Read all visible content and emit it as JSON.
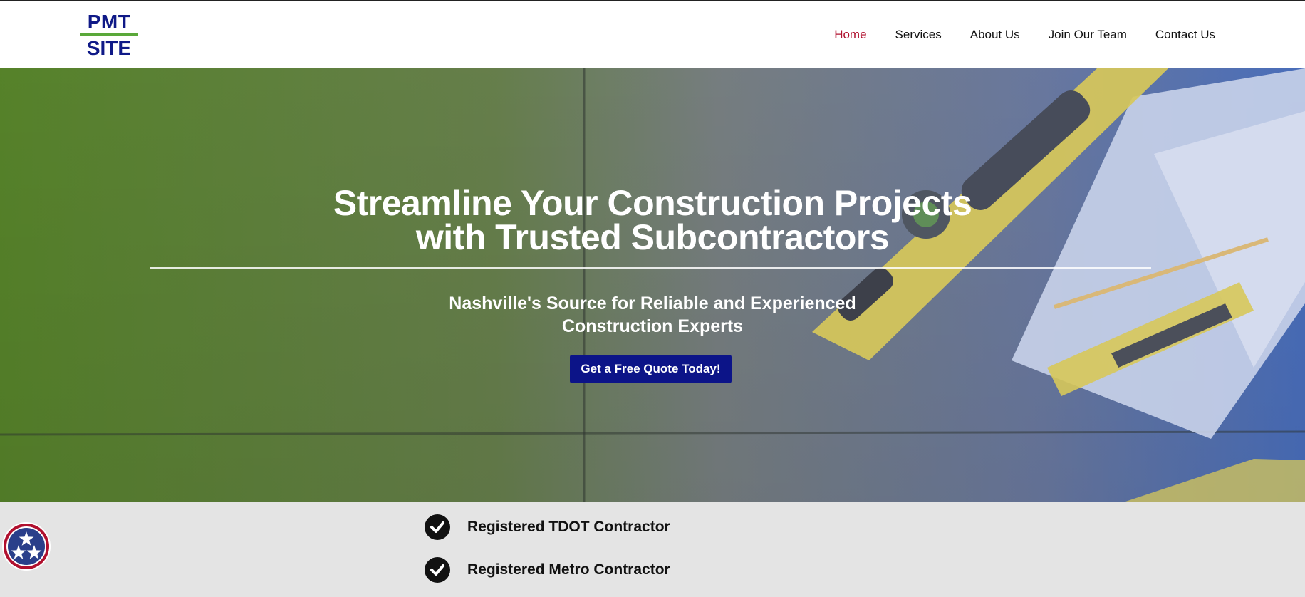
{
  "brand": {
    "line1": "PMT",
    "line2": "SITE",
    "primary_color": "#0f1987",
    "accent_color": "#5aa83a"
  },
  "nav": {
    "items": [
      {
        "label": "Home",
        "active": true
      },
      {
        "label": "Services",
        "active": false
      },
      {
        "label": "About Us",
        "active": false
      },
      {
        "label": "Join Our Team",
        "active": false
      },
      {
        "label": "Contact Us",
        "active": false
      }
    ],
    "active_color": "#b0102e"
  },
  "hero": {
    "title_line1": "Streamline Your Construction Projects",
    "title_line2": "with Trusted Subcontractors",
    "subtitle_line1": "Nashville's Source for Reliable and Experienced",
    "subtitle_line2": "Construction Experts",
    "cta_label": "Get a Free Quote Today!",
    "cta_color": "#0c1488",
    "gradient_colors": [
      "#5a8a2a",
      "#7a8a78",
      "#4a72c8"
    ]
  },
  "badges": {
    "items": [
      {
        "label": "Registered TDOT Contractor",
        "icon": "check-circle-icon"
      },
      {
        "label": "Registered Metro Contractor",
        "icon": "check-circle-icon"
      }
    ],
    "seal_icon": "tennessee-tri-star-icon"
  }
}
